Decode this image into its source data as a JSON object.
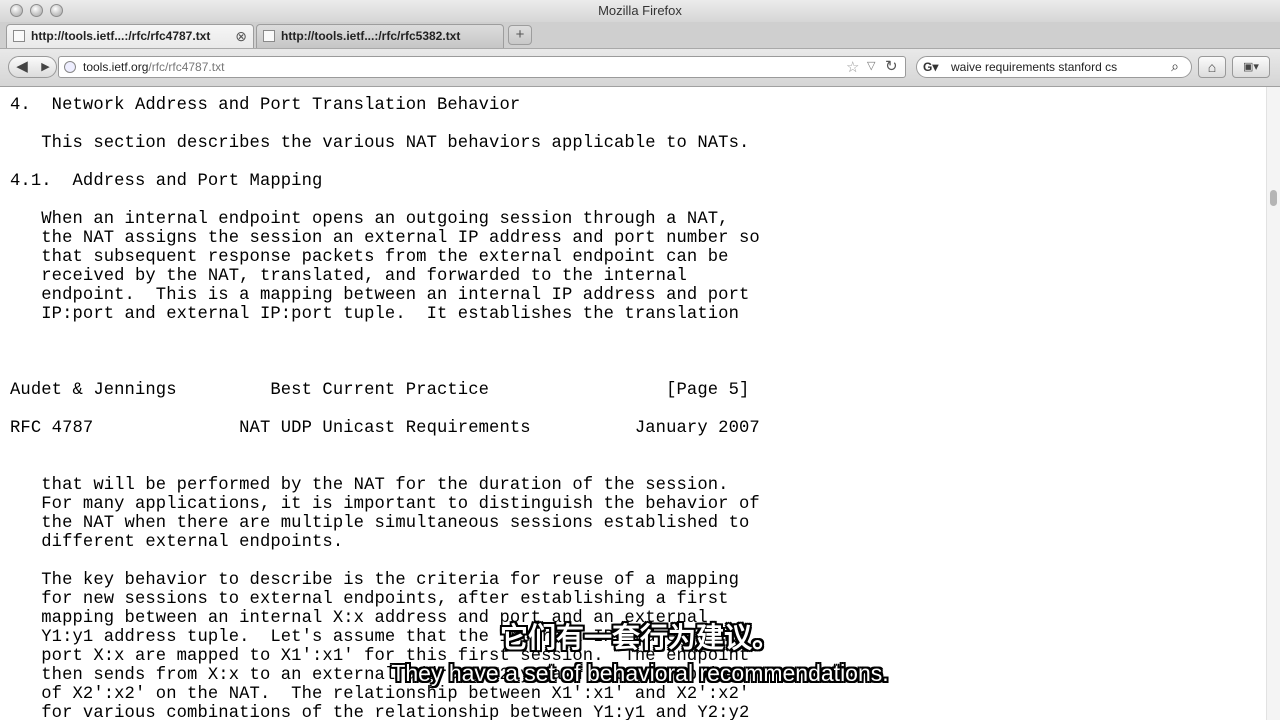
{
  "window": {
    "title": "Mozilla Firefox"
  },
  "tabs": [
    {
      "label": "http://tools.ietf...:/rfc/rfc4787.txt",
      "active": true
    },
    {
      "label": "http://tools.ietf...:/rfc/rfc5382.txt",
      "active": false
    }
  ],
  "new_tab_label": "+",
  "navigation": {
    "back_icon": "back-arrow-icon",
    "forward_icon": "forward-arrow-icon",
    "url_host": "tools.ietf.org",
    "url_path": "/rfc/rfc4787.txt",
    "search_engine_icon": "google-icon",
    "search_value": "waive requirements stanford cs"
  },
  "document": {
    "lines": [
      "4.  Network Address and Port Translation Behavior",
      "   This section describes the various NAT behaviors applicable to NATs.",
      "4.1.  Address and Port Mapping",
      "   When an internal endpoint opens an outgoing session through a NAT,",
      "   the NAT assigns the session an external IP address and port number so",
      "   that subsequent response packets from the external endpoint can be",
      "   received by the NAT, translated, and forwarded to the internal",
      "   endpoint.  This is a mapping between an internal IP address and port",
      "   IP:port and external IP:port tuple.  It establishes the translation",
      "Audet & Jennings         Best Current Practice                 [Page 5]",
      "RFC 4787              NAT UDP Unicast Requirements          January 2007",
      "   that will be performed by the NAT for the duration of the session.",
      "   For many applications, it is important to distinguish the behavior of",
      "   the NAT when there are multiple simultaneous sessions established to",
      "   different external endpoints.",
      "   The key behavior to describe is the criteria for reuse of a mapping",
      "   for new sessions to external endpoints, after establishing a first",
      "   mapping between an internal X:x address and port and an external",
      "   Y1:y1 address tuple.  Let's assume that the internal IP address and",
      "   port X:x are mapped to X1':x1' for this first session.  The endpoint",
      "   then sends from X:x to an external address Y2:y2 and gets a mapping",
      "   of X2':x2' on the NAT.  The relationship between X1':x1' and X2':x2'",
      "   for various combinations of the relationship between Y1:y1 and Y2:y2"
    ]
  },
  "subtitles": {
    "chinese": "它们有一套行为建议。",
    "english": "They have a set of behavioral recommendations."
  }
}
